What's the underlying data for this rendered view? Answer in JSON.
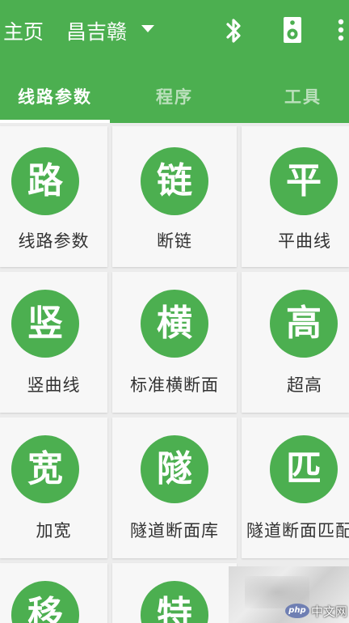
{
  "toolbar": {
    "title": "主页",
    "subtitle": "昌吉赣"
  },
  "icons": {
    "dropdown": "dropdown-arrow-icon",
    "bluetooth": "bluetooth-icon",
    "speaker": "speaker-icon",
    "more": "more-vertical-icon"
  },
  "colors": {
    "primary": "#4caf50",
    "tile_background": "#f7f7f7",
    "label_text": "#333333"
  },
  "tabs": [
    {
      "label": "线路参数",
      "selected": true
    },
    {
      "label": "程序",
      "selected": false
    },
    {
      "label": "工具",
      "selected": false
    }
  ],
  "tiles": [
    {
      "glyph": "路",
      "label": "线路参数"
    },
    {
      "glyph": "链",
      "label": "断链"
    },
    {
      "glyph": "平",
      "label": "平曲线"
    },
    {
      "glyph": "竖",
      "label": "竖曲线"
    },
    {
      "glyph": "横",
      "label": "标准横断面"
    },
    {
      "glyph": "高",
      "label": "超高"
    },
    {
      "glyph": "宽",
      "label": "加宽"
    },
    {
      "glyph": "隧",
      "label": "隧道断面库"
    },
    {
      "glyph": "匹",
      "label": "隧道断面匹配"
    },
    {
      "glyph": "移",
      "label": ""
    },
    {
      "glyph": "特",
      "label": ""
    }
  ],
  "ad": {
    "php": "php",
    "text": "中文网"
  }
}
